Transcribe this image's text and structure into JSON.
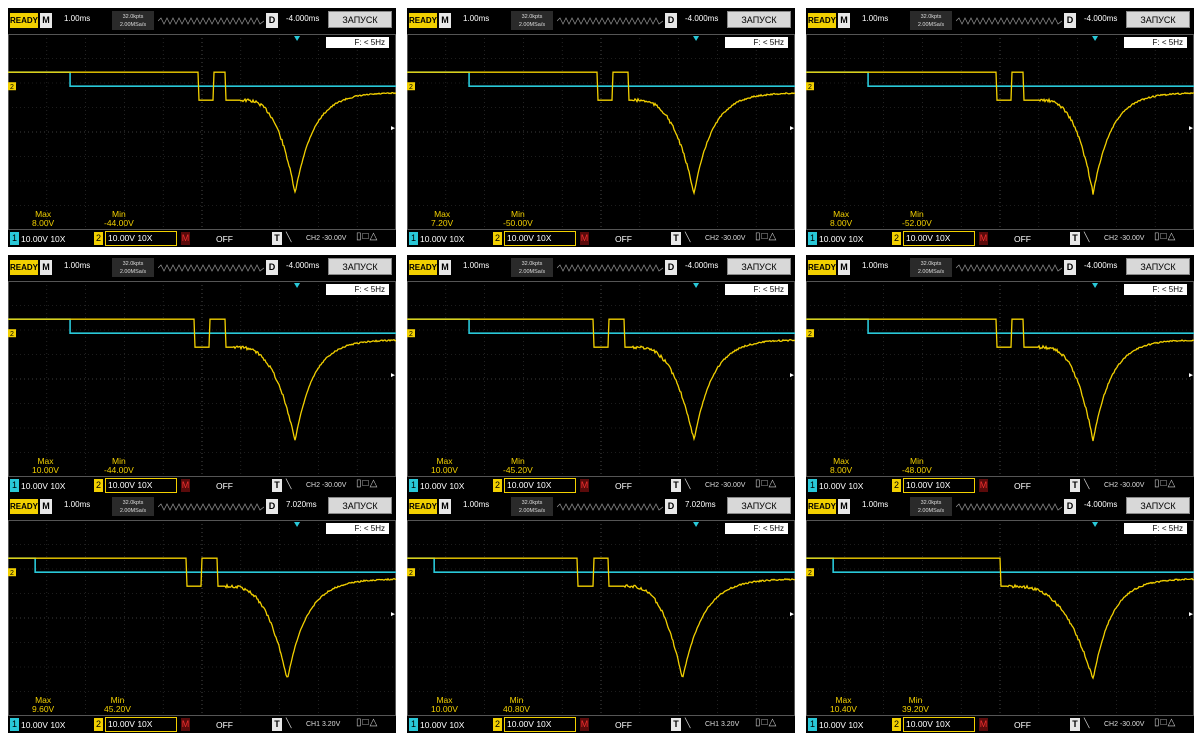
{
  "colors": {
    "ch1": "#29c8d8",
    "ch2": "#f2d000",
    "grid": "#444444",
    "background": "#000000"
  },
  "panels": [
    {
      "status": "READY",
      "mode": "M",
      "timebase": "1.00ms",
      "sample_points": "32.0kpts",
      "sample_rate": "2.00MSa/s",
      "delay_label": "D",
      "delay": "-4.000ms",
      "run_button": "ЗАПУСК",
      "freq": "F: < 5Hz",
      "max_label": "Max",
      "max_value": "8.00V",
      "min_label": "Min",
      "min_value": "-44.00V",
      "ch1_num": "1",
      "ch1_scale": "10.00V",
      "ch1_probe": "10X",
      "ch2_num": "2",
      "ch2_scale": "10.00V",
      "ch2_probe": "10X",
      "math_label": "M",
      "math_state": "OFF",
      "trigger_label": "T",
      "trigger_info": "CH2 -30.00V",
      "trace": {
        "base": 0.195,
        "pulses": [
          [
            0.45,
            0.49
          ],
          [
            0.53,
            0.56
          ]
        ],
        "drop_start": 0.6,
        "dip": 0.74,
        "end_level": 0.3
      }
    },
    {
      "status": "READY",
      "mode": "M",
      "timebase": "1.00ms",
      "sample_points": "32.0kpts",
      "sample_rate": "2.00MSa/s",
      "delay_label": "D",
      "delay": "-4.000ms",
      "run_button": "ЗАПУСК",
      "freq": "F: < 5Hz",
      "max_label": "Max",
      "max_value": "7.20V",
      "min_label": "Min",
      "min_value": "-50.00V",
      "ch1_num": "1",
      "ch1_scale": "10.00V",
      "ch1_probe": "10X",
      "ch2_num": "2",
      "ch2_scale": "10.00V",
      "ch2_probe": "10X",
      "math_label": "M",
      "math_state": "OFF",
      "trigger_label": "T",
      "trigger_info": "CH2 -30.00V",
      "trace": {
        "base": 0.195,
        "pulses": [
          [
            0.45,
            0.49
          ],
          [
            0.53,
            0.57
          ]
        ],
        "drop_start": 0.58,
        "dip": 0.74,
        "end_level": 0.3
      }
    },
    {
      "status": "READY",
      "mode": "M",
      "timebase": "1.00ms",
      "sample_points": "32.0kpts",
      "sample_rate": "2.00MSa/s",
      "delay_label": "D",
      "delay": "-4.000ms",
      "run_button": "ЗАПУСК",
      "freq": "F: < 5Hz",
      "max_label": "Max",
      "max_value": "8.00V",
      "min_label": "Min",
      "min_value": "-52.00V",
      "ch1_num": "1",
      "ch1_scale": "10.00V",
      "ch1_probe": "10X",
      "ch2_num": "2",
      "ch2_scale": "10.00V",
      "ch2_probe": "10X",
      "math_label": "M",
      "math_state": "OFF",
      "trigger_label": "T",
      "trigger_info": "CH2 -30.00V",
      "trace": {
        "base": 0.195,
        "pulses": [
          [
            0.45,
            0.49
          ],
          [
            0.53,
            0.56
          ]
        ],
        "drop_start": 0.6,
        "dip": 0.74,
        "end_level": 0.3
      }
    },
    {
      "status": "READY",
      "mode": "M",
      "timebase": "1.00ms",
      "sample_points": "32.0kpts",
      "sample_rate": "2.00MSa/s",
      "delay_label": "D",
      "delay": "-4.000ms",
      "run_button": "ЗАПУСК",
      "freq": "F: < 5Hz",
      "max_label": "Max",
      "max_value": "10.00V",
      "min_label": "Min",
      "min_value": "-44.00V",
      "ch1_num": "1",
      "ch1_scale": "10.00V",
      "ch1_probe": "10X",
      "ch2_num": "2",
      "ch2_scale": "10.00V",
      "ch2_probe": "10X",
      "math_label": "M",
      "math_state": "OFF",
      "trigger_label": "T",
      "trigger_info": "CH2 -30.00V",
      "trace": {
        "base": 0.195,
        "pulses": [
          [
            0.44,
            0.48
          ],
          [
            0.52,
            0.56
          ]
        ],
        "drop_start": 0.58,
        "dip": 0.74,
        "end_level": 0.3
      }
    },
    {
      "status": "READY",
      "mode": "M",
      "timebase": "1.00ms",
      "sample_points": "32.0kpts",
      "sample_rate": "2.00MSa/s",
      "delay_label": "D",
      "delay": "-4.000ms",
      "run_button": "ЗАПУСК",
      "freq": "F: < 5Hz",
      "max_label": "Max",
      "max_value": "10.00V",
      "min_label": "Min",
      "min_value": "-45.20V",
      "ch1_num": "1",
      "ch1_scale": "10.00V",
      "ch1_probe": "10X",
      "ch2_num": "2",
      "ch2_scale": "10.00V",
      "ch2_probe": "10X",
      "math_label": "M",
      "math_state": "OFF",
      "trigger_label": "T",
      "trigger_info": "CH2 -30.00V",
      "trace": {
        "base": 0.195,
        "pulses": [
          [
            0.44,
            0.48
          ],
          [
            0.52,
            0.56
          ]
        ],
        "drop_start": 0.58,
        "dip": 0.74,
        "end_level": 0.3
      }
    },
    {
      "status": "READY",
      "mode": "M",
      "timebase": "1.00ms",
      "sample_points": "32.0kpts",
      "sample_rate": "2.00MSa/s",
      "delay_label": "D",
      "delay": "-4.000ms",
      "run_button": "ЗАПУСК",
      "freq": "F: < 5Hz",
      "max_label": "Max",
      "max_value": "8.00V",
      "min_label": "Min",
      "min_value": "-48.00V",
      "ch1_num": "1",
      "ch1_scale": "10.00V",
      "ch1_probe": "10X",
      "ch2_num": "2",
      "ch2_scale": "10.00V",
      "ch2_probe": "10X",
      "math_label": "M",
      "math_state": "OFF",
      "trigger_label": "T",
      "trigger_info": "CH2 -30.00V",
      "trace": {
        "base": 0.195,
        "pulses": [
          [
            0.45,
            0.49
          ],
          [
            0.53,
            0.56
          ]
        ],
        "drop_start": 0.6,
        "dip": 0.74,
        "end_level": 0.3
      }
    },
    {
      "status": "READY",
      "mode": "M",
      "timebase": "1.00ms",
      "sample_points": "32.0kpts",
      "sample_rate": "2.00MSa/s",
      "delay_label": "D",
      "delay": "7.020ms",
      "run_button": "ЗАПУСК",
      "freq": "F: < 5Hz",
      "max_label": "Max",
      "max_value": "9.60V",
      "min_label": "Min",
      "min_value": "45.20V",
      "ch1_num": "1",
      "ch1_scale": "10.00V",
      "ch1_probe": "10X",
      "ch2_num": "2",
      "ch2_scale": "10.00V",
      "ch2_probe": "10X",
      "math_label": "M",
      "math_state": "OFF",
      "trigger_label": "T",
      "trigger_info": "CH1 3.20V",
      "trace": {
        "base": 0.195,
        "pulses": [
          [
            0.42,
            0.46
          ],
          [
            0.5,
            0.54
          ]
        ],
        "drop_start": 0.56,
        "dip": 0.72,
        "end_level": 0.3
      }
    },
    {
      "status": "READY",
      "mode": "M",
      "timebase": "1.00ms",
      "sample_points": "32.0kpts",
      "sample_rate": "2.00MSa/s",
      "delay_label": "D",
      "delay": "7.020ms",
      "run_button": "ЗАПУСК",
      "freq": "F: < 5Hz",
      "max_label": "Max",
      "max_value": "10.00V",
      "min_label": "Min",
      "min_value": "40.80V",
      "ch1_num": "1",
      "ch1_scale": "10.00V",
      "ch1_probe": "10X",
      "ch2_num": "2",
      "ch2_scale": "10.00V",
      "ch2_probe": "10X",
      "math_label": "M",
      "math_state": "OFF",
      "trigger_label": "T",
      "trigger_info": "CH1 3.20V",
      "trace": {
        "base": 0.195,
        "pulses": [
          [
            0.4,
            0.44
          ],
          [
            0.48,
            0.52
          ]
        ],
        "drop_start": 0.56,
        "dip": 0.71,
        "end_level": 0.3
      }
    },
    {
      "status": "READY",
      "mode": "M",
      "timebase": "1.00ms",
      "sample_points": "32.0kpts",
      "sample_rate": "2.00MSa/s",
      "delay_label": "D",
      "delay": "-4.000ms",
      "run_button": "ЗАПУСК",
      "freq": "F: < 5Hz",
      "max_label": "Max",
      "max_value": "10.40V",
      "min_label": "Min",
      "min_value": "39.20V",
      "ch1_num": "1",
      "ch1_scale": "10.00V",
      "ch1_probe": "10X",
      "ch2_num": "2",
      "ch2_scale": "10.00V",
      "ch2_probe": "10X",
      "math_label": "M",
      "math_state": "OFF",
      "trigger_label": "T",
      "trigger_info": "CH2 -30.00V",
      "trace": {
        "base": 0.195,
        "pulses": [
          [
            0.44,
            0.5
          ]
        ],
        "drop_start": 0.52,
        "dip": 0.74,
        "end_level": 0.3
      }
    }
  ]
}
